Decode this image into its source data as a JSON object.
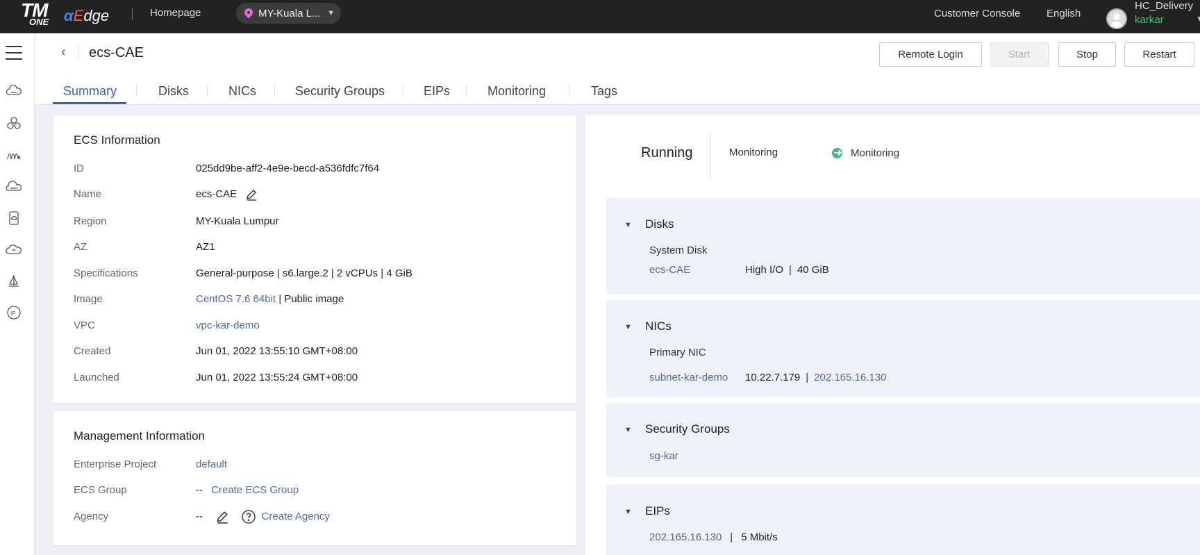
{
  "topbar": {
    "logo_tm": "TM",
    "logo_one": "ONE",
    "logo_edge_a": "α",
    "logo_edge_e": "E",
    "logo_edge_rest": "dge",
    "homepage": "Homepage",
    "region": "MY-Kuala L...",
    "customer_console": "Customer Console",
    "language": "English",
    "user_org": "HC_Delivery",
    "user_name": "karkar"
  },
  "sidebar": {
    "icons": [
      "cloud-server-icon",
      "cluster-icon",
      "network-icon",
      "storage-icon",
      "container-icon",
      "cloud-icon",
      "sailboat-icon",
      "ip-icon"
    ]
  },
  "header": {
    "title": "ecs-CAE",
    "buttons": {
      "remote_login": "Remote Login",
      "start": "Start",
      "stop": "Stop",
      "restart": "Restart"
    },
    "tabs": [
      "Summary",
      "Disks",
      "NICs",
      "Security Groups",
      "EIPs",
      "Monitoring",
      "Tags"
    ],
    "active_tab": "Summary"
  },
  "ecs_info": {
    "title": "ECS Information",
    "rows": [
      {
        "label": "ID",
        "value": "025dd9be-aff2-4e9e-becd-a536fdfc7f64"
      },
      {
        "label": "Name",
        "value": "ecs-CAE"
      },
      {
        "label": "Region",
        "value": "MY-Kuala Lumpur"
      },
      {
        "label": "AZ",
        "value": "AZ1"
      },
      {
        "label": "Specifications",
        "value": "General-purpose | s6.large.2 | 2 vCPUs | 4 GiB"
      },
      {
        "label": "Image",
        "value_link": "CentOS 7.6 64bit",
        "value_suffix": " | Public image"
      },
      {
        "label": "VPC",
        "value_link": "vpc-kar-demo"
      },
      {
        "label": "Created",
        "value": "Jun 01, 2022 13:55:10 GMT+08:00"
      },
      {
        "label": "Launched",
        "value": "Jun 01, 2022 13:55:24 GMT+08:00"
      }
    ]
  },
  "mgmt_info": {
    "title": "Management Information",
    "enterprise_project_label": "Enterprise Project",
    "enterprise_project_value": "default",
    "ecs_group_label": "ECS Group",
    "ecs_group_value": "--",
    "ecs_group_link": "Create ECS Group",
    "agency_label": "Agency",
    "agency_value": "--",
    "agency_link": "Create Agency"
  },
  "status_panel": {
    "status": "Running",
    "monitoring_label": "Monitoring",
    "monitoring_value": "Monitoring",
    "monitoring_color": "#3ab77f"
  },
  "sections": {
    "disks": {
      "title": "Disks",
      "sub": "System Disk",
      "link": "ecs-CAE",
      "type": "High I/O",
      "size": "40 GiB"
    },
    "nics": {
      "title": "NICs",
      "sub": "Primary NIC",
      "link": "subnet-kar-demo",
      "ip": "10.22.7.179",
      "eip": "202.165.16.130"
    },
    "security_groups": {
      "title": "Security Groups",
      "link": "sg-kar"
    },
    "eips": {
      "title": "EIPs",
      "link": "202.165.16.130",
      "bandwidth": "5 Mbit/s"
    }
  },
  "colors": {
    "accent": "#3a62ad",
    "link": "#4f6aa7",
    "topbar": "#222222",
    "success": "#3ab77f"
  }
}
